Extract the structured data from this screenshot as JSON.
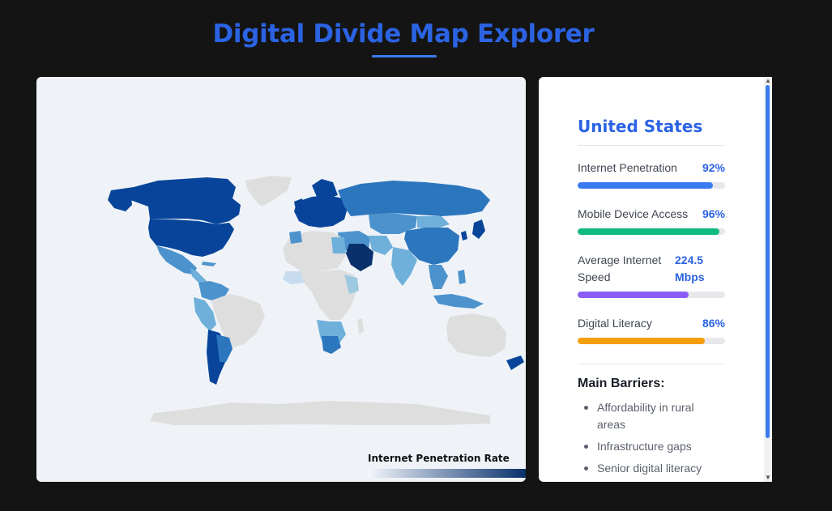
{
  "header": {
    "title": "Digital Divide Map Explorer"
  },
  "map": {
    "legend_title": "Internet Penetration Rate",
    "legend_colors": {
      "low": "#f3f7fc",
      "high": "#08306b",
      "no_data": "#dedede",
      "background": "#eff3f8"
    }
  },
  "panel": {
    "country": "United States",
    "metrics": [
      {
        "label": "Internet Penetration",
        "value": "92%",
        "fraction": 0.92,
        "color": "#3b7bf0"
      },
      {
        "label": "Mobile Device Access",
        "value": "96%",
        "fraction": 0.96,
        "color": "#10b981"
      },
      {
        "label_line1": "Average Internet",
        "label_line2": "Speed",
        "value_line1": "224.5",
        "value_line2": "Mbps",
        "fraction": 0.75,
        "color": "#8b5cf6"
      },
      {
        "label": "Digital Literacy",
        "value": "86%",
        "fraction": 0.86,
        "color": "#f59e0b"
      }
    ],
    "barriers_title": "Main Barriers:",
    "barriers": [
      {
        "line1": "Affordability in rural",
        "line2": "areas"
      },
      {
        "line1": "Infrastructure gaps"
      },
      {
        "line1": "Senior digital literacy"
      }
    ]
  }
}
